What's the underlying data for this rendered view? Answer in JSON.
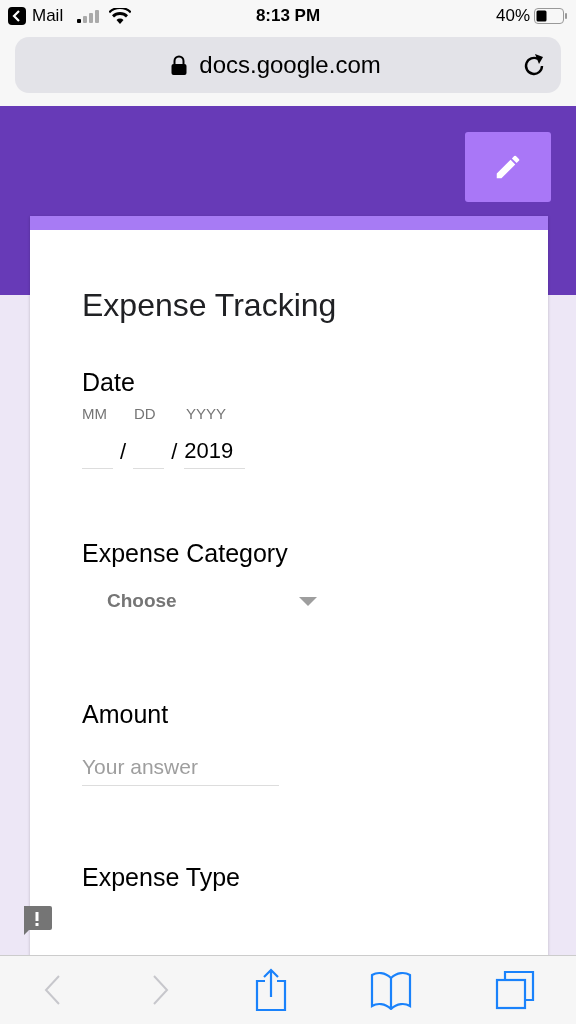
{
  "status_bar": {
    "back_app": "Mail",
    "time": "8:13 PM",
    "battery": "40%"
  },
  "url_bar": {
    "url": "docs.google.com"
  },
  "form": {
    "title": "Expense Tracking",
    "questions": [
      {
        "kind": "date",
        "title": "Date",
        "month_label": "MM",
        "day_label": "DD",
        "year_label": "YYYY",
        "separators": [
          "/",
          "/"
        ],
        "year_value": "2019"
      },
      {
        "kind": "dropdown",
        "title": "Expense Category",
        "value": "Choose"
      },
      {
        "kind": "text",
        "title": "Amount",
        "placeholder": "Your answer"
      },
      {
        "kind": "cut",
        "title": "Expense Type"
      }
    ]
  }
}
